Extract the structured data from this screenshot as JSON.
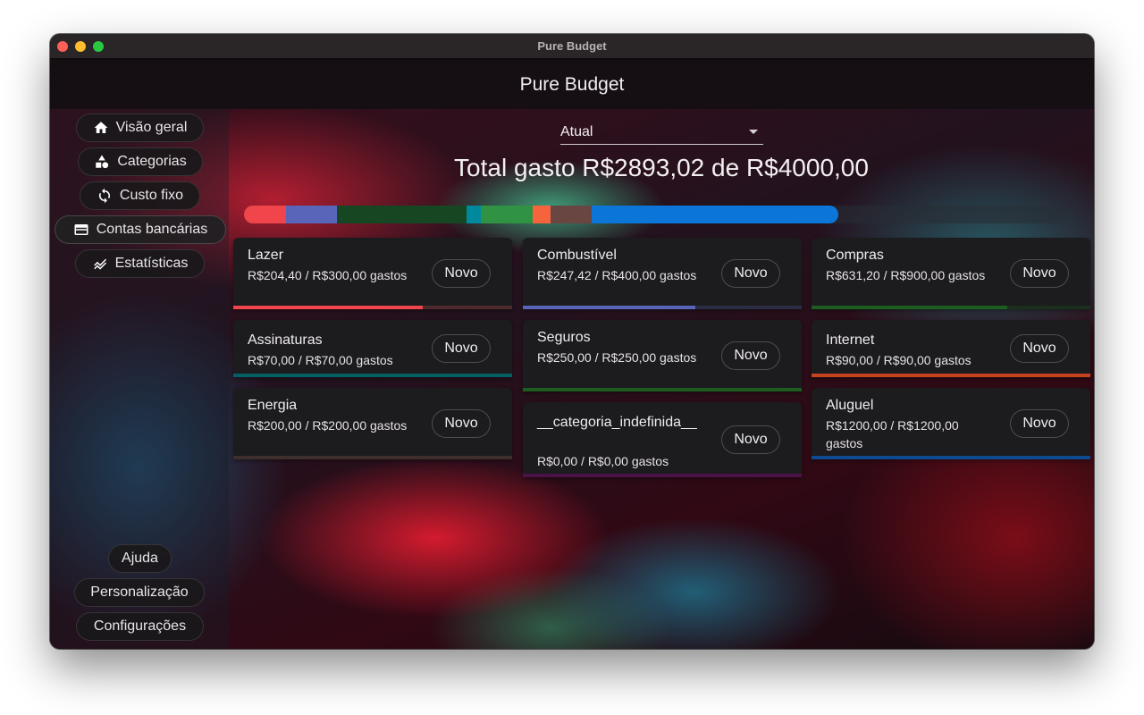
{
  "window": {
    "title": "Pure Budget"
  },
  "appbar": {
    "title": "Pure Budget"
  },
  "sidebar": {
    "items": [
      {
        "label": "Visão geral",
        "icon": "home-icon"
      },
      {
        "label": "Categorias",
        "icon": "shapes-icon"
      },
      {
        "label": "Custo fixo",
        "icon": "refresh-icon"
      },
      {
        "label": "Contas bancárias",
        "icon": "wallet-icon"
      },
      {
        "label": "Estatísticas",
        "icon": "chart-line-icon"
      }
    ],
    "bottom_items": [
      {
        "label": "Ajuda"
      },
      {
        "label": "Personalização"
      },
      {
        "label": "Configurações"
      }
    ]
  },
  "period_select": {
    "value": "Atual"
  },
  "total": {
    "text": "Total gasto R$2893,02 de R$4000,00"
  },
  "budget_bar": {
    "segments": [
      {
        "category": "Lazer",
        "amount": 204.4,
        "color": "#f0454b"
      },
      {
        "category": "Combustível",
        "amount": 247.42,
        "color": "#5965b8"
      },
      {
        "category": "Compras",
        "amount": 631.2,
        "color": "#174623"
      },
      {
        "category": "Assinaturas",
        "amount": 70.0,
        "color": "#00889d"
      },
      {
        "category": "Seguros",
        "amount": 250.0,
        "color": "#2f9343"
      },
      {
        "category": "Internet",
        "amount": 90.0,
        "color": "#f6643d"
      },
      {
        "category": "Energia",
        "amount": 200.0,
        "color": "#6a4642"
      },
      {
        "category": "Aluguel",
        "amount": 1200.0,
        "color": "#0b75d8"
      }
    ],
    "total_budget": 4000.0
  },
  "categories": [
    {
      "name": "Lazer",
      "amount": "R$204,40 / R$300,00 gastos",
      "button": "Novo",
      "color": "#f0454b",
      "track": "#4d2a2e",
      "ratio": 0.681
    },
    {
      "name": "Assinaturas",
      "amount": "R$70,00 / R$70,00 gastos",
      "button": "Novo",
      "color": "#006064",
      "track": "#1d3335",
      "ratio": 1.0
    },
    {
      "name": "Energia",
      "amount": "R$200,00 / R$200,00 gastos",
      "button": "Novo",
      "color": "#3e2f2c",
      "track": "#2f2624",
      "ratio": 1.0
    },
    {
      "name": "Combustível",
      "amount": "R$247,42 / R$400,00 gastos",
      "button": "Novo",
      "color": "#5965b8",
      "track": "#2b2d44",
      "ratio": 0.619
    },
    {
      "name": "Seguros",
      "amount": "R$250,00 / R$250,00 gastos",
      "button": "Novo",
      "color": "#1b5e20",
      "track": "#1c2f1e",
      "ratio": 1.0
    },
    {
      "name": "__categoria_indefinida__",
      "amount": "R$0,00 / R$0,00 gastos",
      "button": "Novo",
      "color": "#4a1246",
      "track": "#4a1246",
      "ratio": 1.0
    },
    {
      "name": "Compras",
      "amount": "R$631,20 / R$900,00 gastos",
      "button": "Novo",
      "color": "#1b5e20",
      "track": "#1a2f1c",
      "ratio": 0.701
    },
    {
      "name": "Internet",
      "amount": "R$90,00 / R$90,00 gastos",
      "button": "Novo",
      "color": "#c4441d",
      "track": "#3b231b",
      "ratio": 1.0
    },
    {
      "name": "Aluguel",
      "amount": "R$1200,00 / R$1200,00 gastos",
      "button": "Novo",
      "color": "#0d4a8f",
      "track": "#1a2a3d",
      "ratio": 1.0
    }
  ]
}
